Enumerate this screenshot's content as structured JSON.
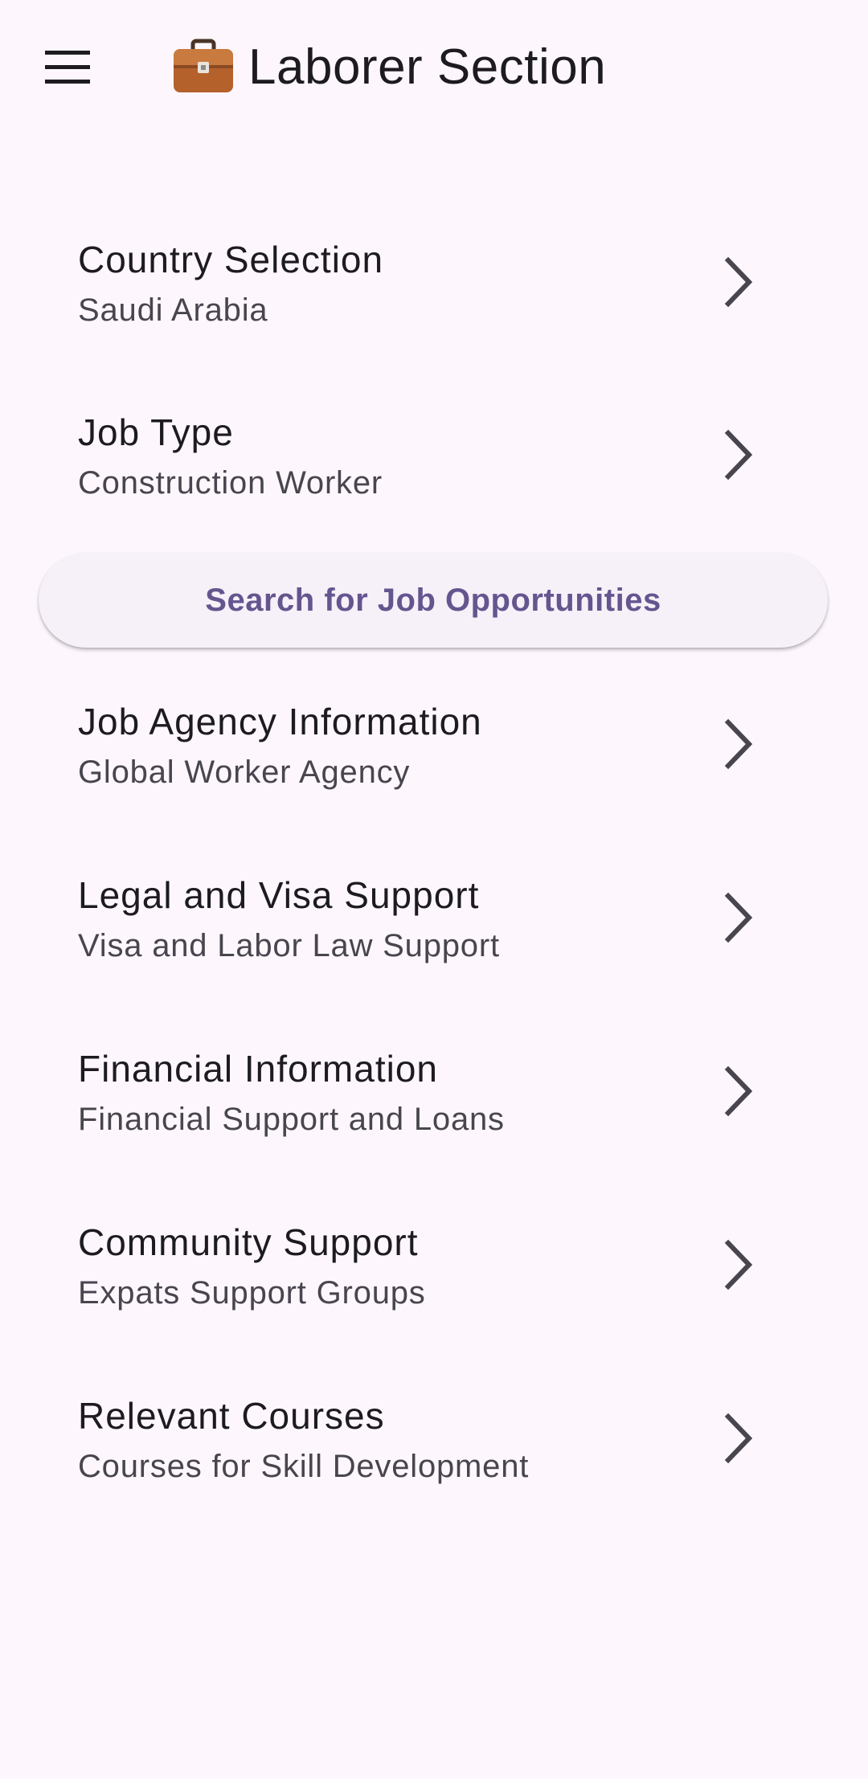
{
  "app_bar": {
    "title": "Laborer Section",
    "leading_icon": "menu-icon",
    "title_icon": "briefcase-icon"
  },
  "items": [
    {
      "title": "Country Selection",
      "subtitle": "Saudi Arabia",
      "trailing_icon": "chevron-right-icon"
    },
    {
      "title": "Job Type",
      "subtitle": "Construction Worker",
      "trailing_icon": "chevron-right-icon"
    },
    {
      "title": "Job Agency Information",
      "subtitle": "Global Worker Agency",
      "trailing_icon": "chevron-right-icon"
    },
    {
      "title": "Legal and Visa Support",
      "subtitle": "Visa and Labor Law Support",
      "trailing_icon": "chevron-right-icon"
    },
    {
      "title": "Financial Information",
      "subtitle": "Financial Support and Loans",
      "trailing_icon": "chevron-right-icon"
    },
    {
      "title": "Community Support",
      "subtitle": "Expats Support Groups",
      "trailing_icon": "chevron-right-icon"
    },
    {
      "title": "Relevant Courses",
      "subtitle": "Courses for Skill Development",
      "trailing_icon": "chevron-right-icon"
    }
  ],
  "search_button": {
    "label": "Search for Job Opportunities"
  },
  "colors": {
    "background": "#fdf7fd",
    "accent": "#65558f",
    "text_primary": "#1d1b20",
    "text_secondary": "#49454f",
    "button_surface": "#f6f1f8"
  }
}
